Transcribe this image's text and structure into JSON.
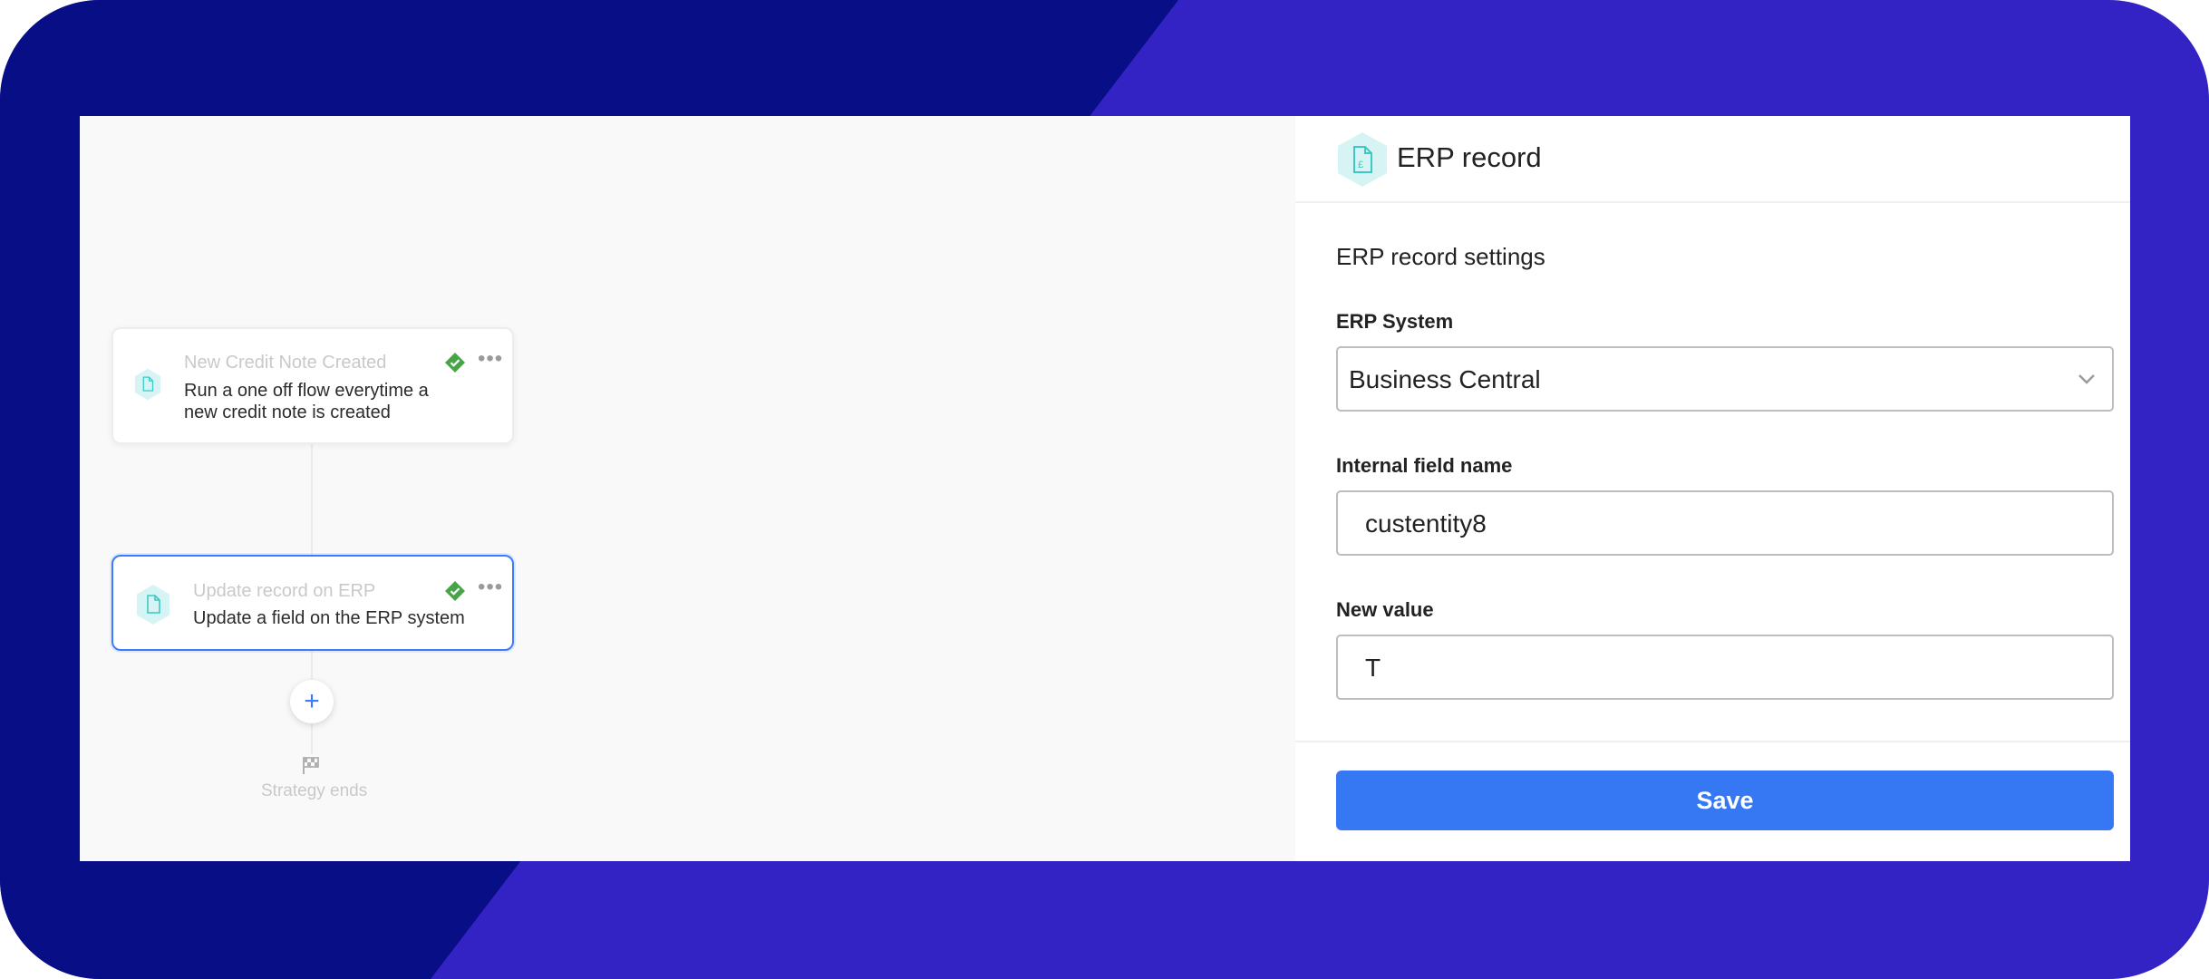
{
  "colors": {
    "bg_dark": "#070e86",
    "bg_light": "#3322c4",
    "accent": "#3678f3",
    "teal_icon": "#3cc9c3",
    "check_green": "#47a447"
  },
  "flow": {
    "nodes": [
      {
        "title": "New Credit Note Created",
        "description": "Run a one off flow everytime a new credit note is created",
        "icon": "document-icon",
        "status_icon": "check-icon",
        "menu_icon": "more-icon"
      },
      {
        "title": "Update record on ERP",
        "description": "Update a field on the ERP system",
        "icon": "document-icon",
        "status_icon": "check-icon",
        "menu_icon": "more-icon"
      }
    ],
    "add_button_label": "+",
    "end_label": "Strategy ends"
  },
  "panel": {
    "title": "ERP record",
    "section_title": "ERP record settings",
    "erp_system": {
      "label": "ERP System",
      "value": "Business Central"
    },
    "internal_field": {
      "label": "Internal field name",
      "value": "custentity8"
    },
    "new_value": {
      "label": "New value",
      "value": "T"
    },
    "save_label": "Save"
  }
}
